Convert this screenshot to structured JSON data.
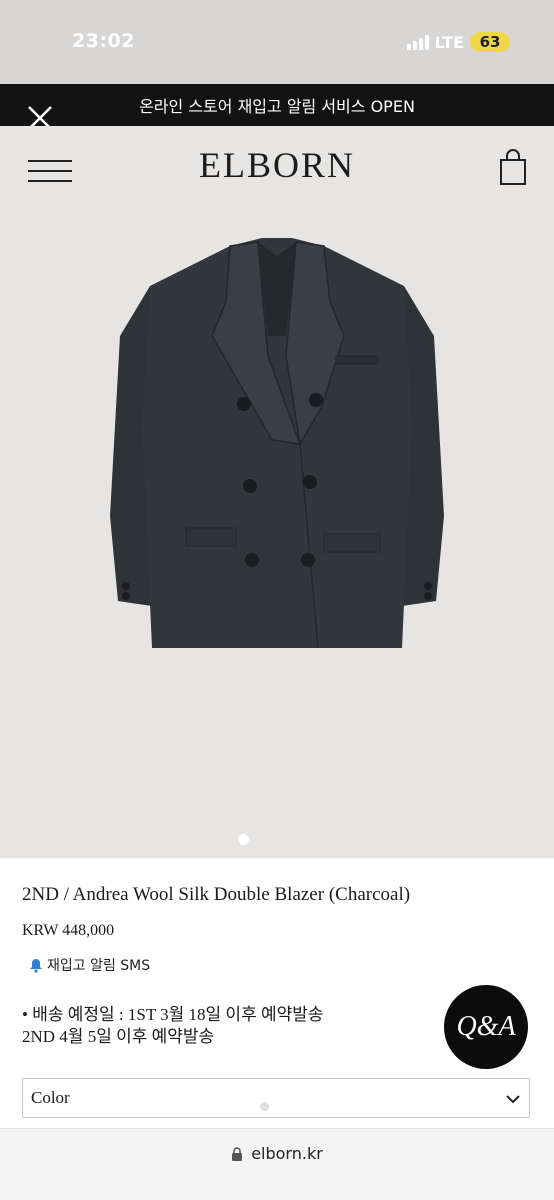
{
  "status_bar": {
    "time": "23:02",
    "network": "LTE",
    "battery": "63"
  },
  "promo": {
    "text": "온라인 스토어 재입고 알림 서비스 OPEN"
  },
  "header": {
    "logo": "ELBORN"
  },
  "product": {
    "title": "2ND / Andrea Wool Silk Double Blazer (Charcoal)",
    "price": "KRW 448,000",
    "restock_link": "재입고 알림 SMS",
    "shipping_line1": "• 배송 예정일 : 1ST 3월 18일 이후 예약발송",
    "shipping_line2": "2ND 4월 5일 이후 예약발송",
    "image_pager": {
      "current": 1,
      "total": 1
    }
  },
  "qa_button": {
    "label": "Q&A"
  },
  "option_select": {
    "selected_label": "Color"
  },
  "browser": {
    "url": "elborn.kr"
  },
  "colors": {
    "header_bg": "#e6e5e3",
    "promo_bg": "#121212",
    "jacket": "#33363b"
  }
}
